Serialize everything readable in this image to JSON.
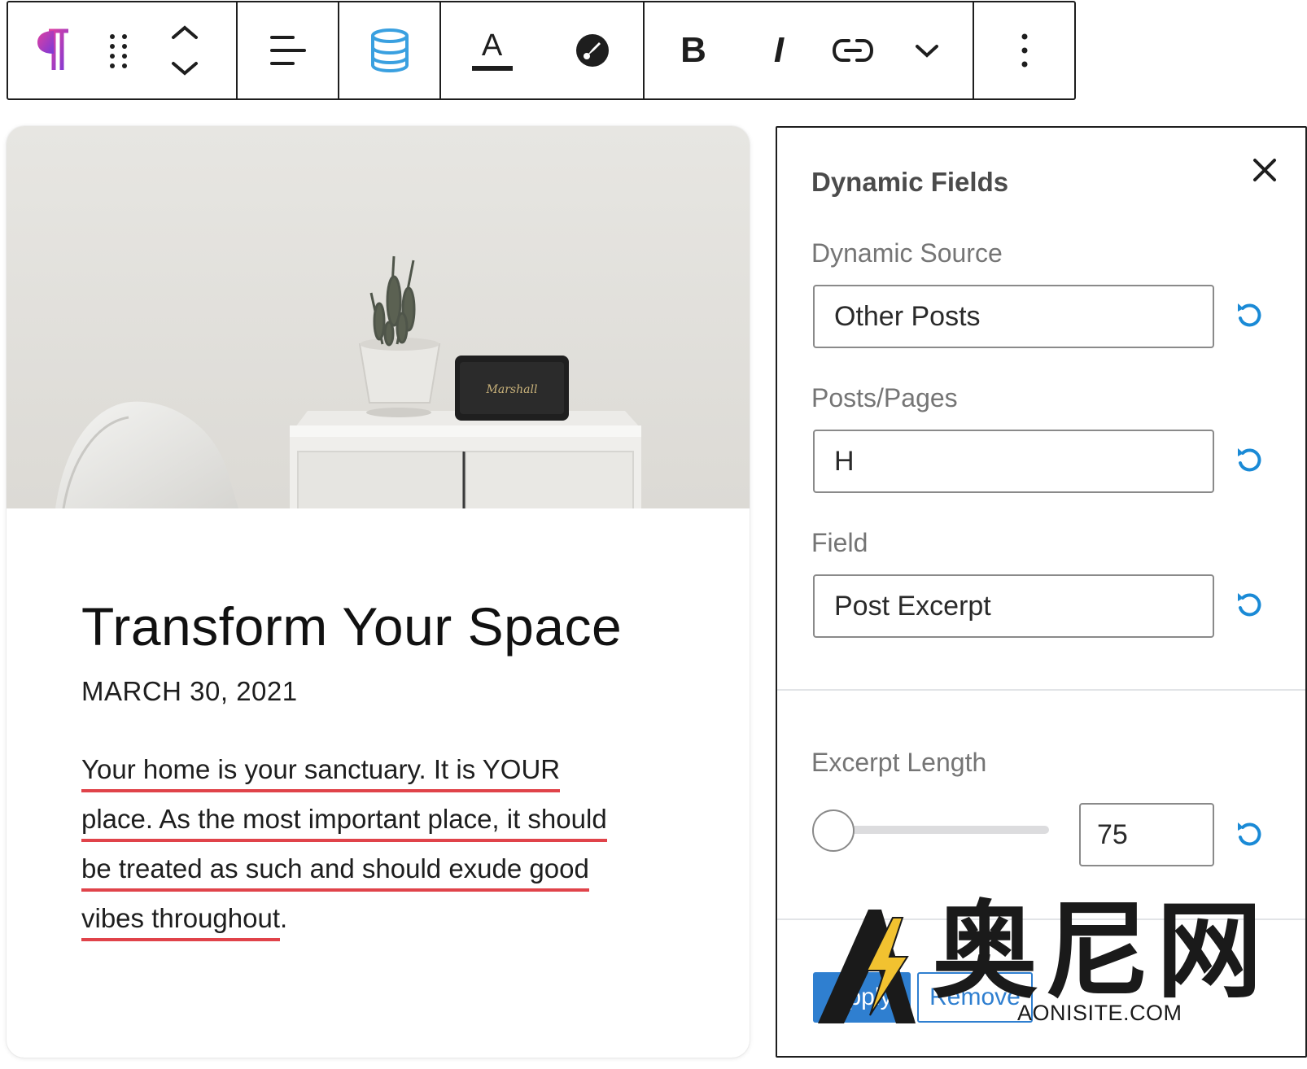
{
  "toolbar": {
    "groups": [
      {
        "items": [
          "paragraph-icon",
          "drag-handle-icon",
          "move-up-down-icon"
        ]
      },
      {
        "items": [
          "align-left-icon"
        ]
      },
      {
        "items": [
          "database-icon"
        ]
      },
      {
        "items": [
          "text-color-icon",
          "highlight-icon"
        ],
        "text_color_glyph": "A"
      },
      {
        "items": [
          "bold-icon",
          "italic-icon",
          "link-icon",
          "chevron-down-icon"
        ],
        "bold_glyph": "B",
        "italic_glyph": "I"
      },
      {
        "items": [
          "more-options-icon"
        ]
      }
    ],
    "accent": "#3aa0e0",
    "paragraph_gradient": [
      "#e040a0",
      "#7a3ad8"
    ]
  },
  "card": {
    "title": "Transform Your Space",
    "date": "MARCH 30, 2021",
    "excerpt_lines": [
      "Your home is your sanctuary. It is YOUR",
      "place. As the most important place, it should",
      "be treated as such and should exude good",
      "vibes throughout"
    ],
    "excerpt_end": ".",
    "speaker_brand": "Marshall",
    "underline_color": "#e0434a"
  },
  "panel": {
    "title": "Dynamic Fields",
    "fields": [
      {
        "label": "Dynamic Source",
        "value": "Other Posts"
      },
      {
        "label": "Posts/Pages",
        "value": "H"
      },
      {
        "label": "Field",
        "value": "Post Excerpt"
      }
    ],
    "excerpt_length": {
      "label": "Excerpt Length",
      "value": "75",
      "slider_fraction": 0.0
    },
    "apply_label": "Apply",
    "remove_label": "Remove",
    "accent": "#1a8ad6"
  },
  "watermark": {
    "cjk": "奥尼网",
    "domain": "AONISITE.COM"
  }
}
